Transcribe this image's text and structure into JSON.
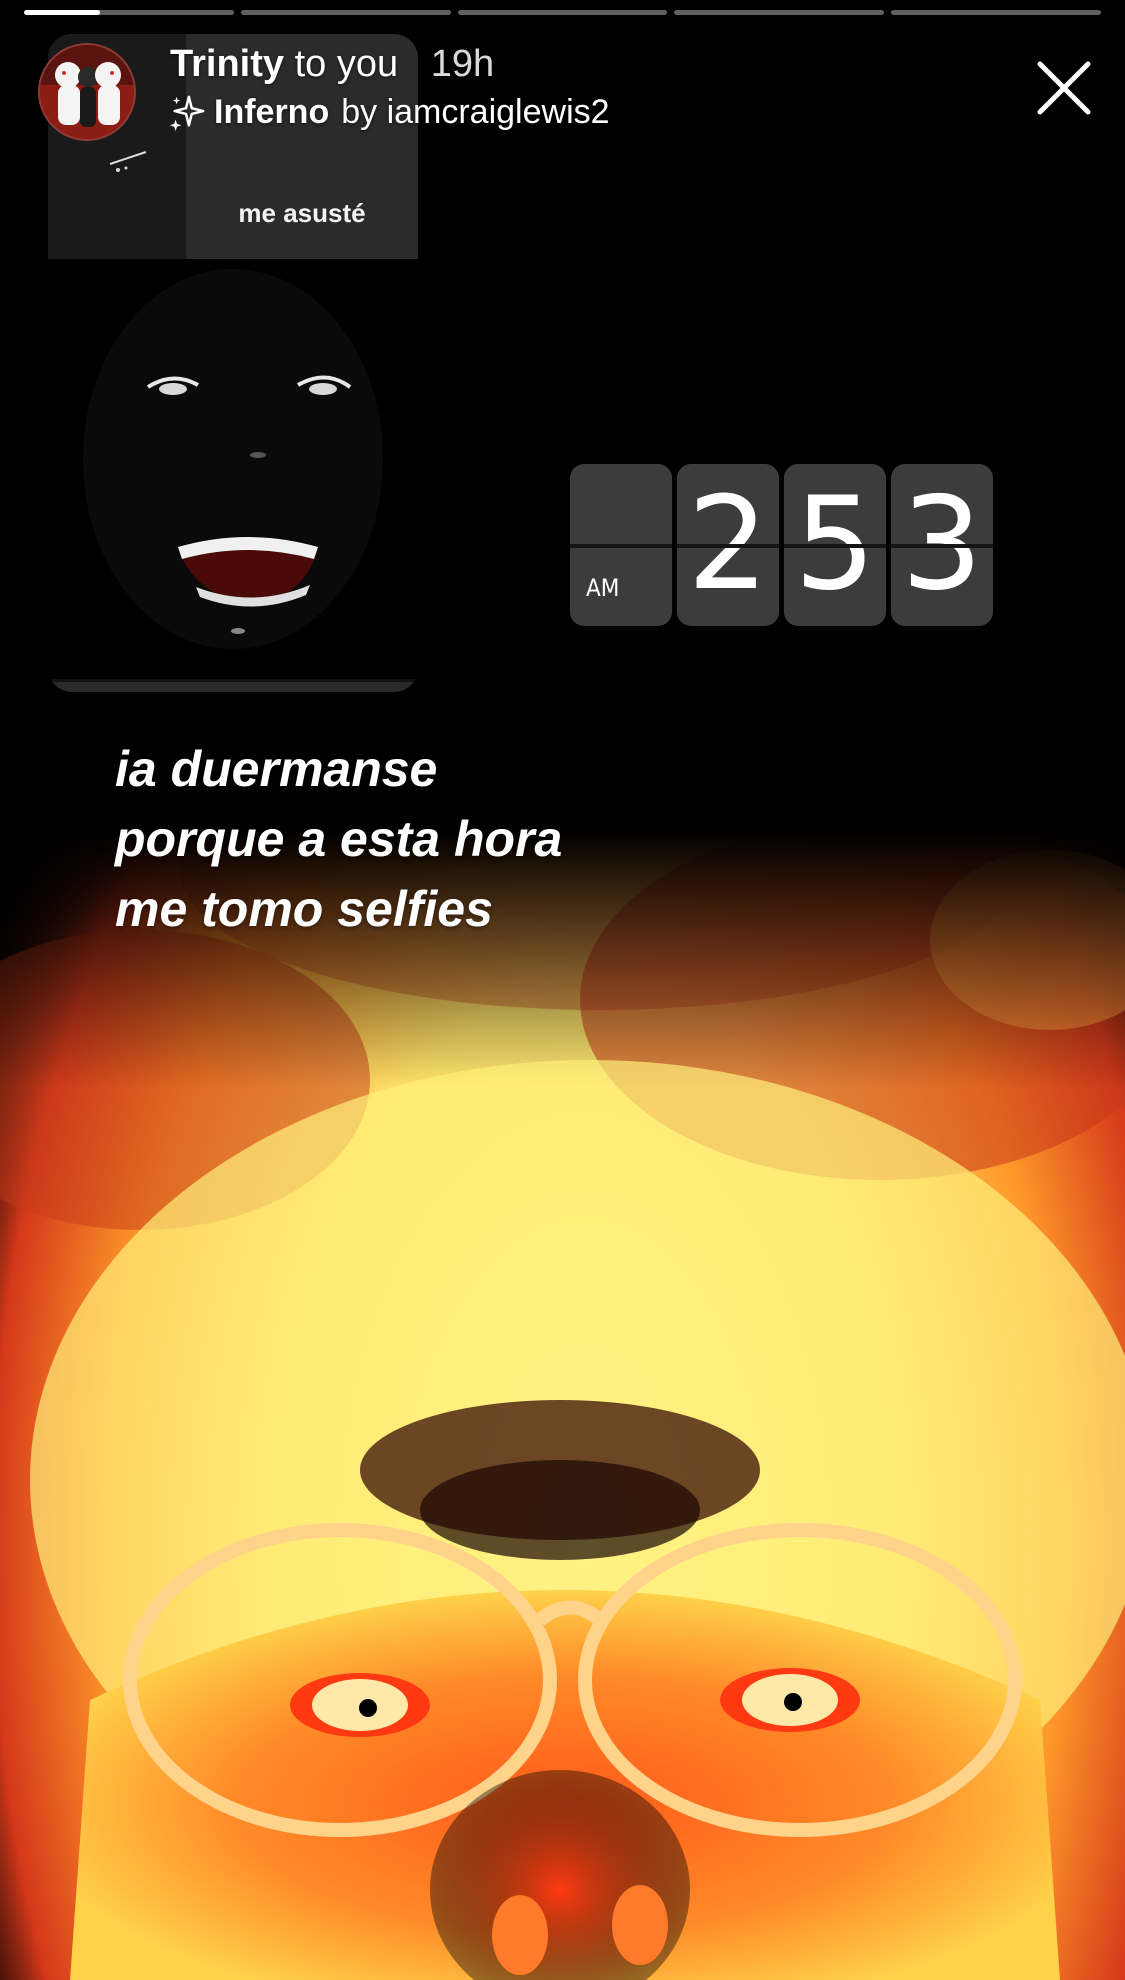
{
  "story": {
    "progress_segments": [
      {
        "fill": 0.36
      },
      {
        "fill": 0
      },
      {
        "fill": 0
      },
      {
        "fill": 0
      },
      {
        "fill": 0
      }
    ],
    "header": {
      "username": "Trinity",
      "recipient_text": "to you",
      "time": "19h",
      "effect_name": "Inferno",
      "effect_by": "by iamcraiglewis2",
      "sparkle_icon": "sparkle-icon",
      "close_icon": "close-icon"
    },
    "embedded_card": {
      "caption": "me asusté"
    },
    "clock": {
      "ampm": "AM",
      "digits": [
        "2",
        "5",
        "3"
      ]
    },
    "overlay_text": {
      "lines": [
        "ia duermanse",
        "porque a esta hora",
        "me tomo selfies"
      ]
    },
    "colors": {
      "flame_yellow": "#fffb8f",
      "flame_orange": "#ff8a1e",
      "flame_red": "#e0401a",
      "background": "#000000"
    }
  }
}
